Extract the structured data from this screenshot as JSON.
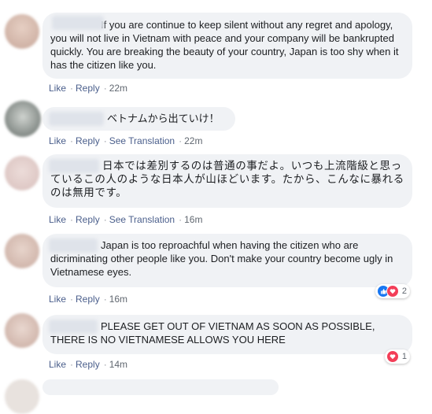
{
  "labels": {
    "like": "Like",
    "reply": "Reply",
    "see_translation": "See Translation",
    "sep": "·"
  },
  "comments": [
    {
      "text": "If you are continue to keep silent without any regret and apology, you will not live in Vietnam with peace and your company will be bankrupted quickly. You are breaking the beauty of your country, Japan is too shy when it has the citizen like you.",
      "time": "22m"
    },
    {
      "text": "ベトナムから出ていけ！",
      "time": "22m"
    },
    {
      "text": "日本では差別するのは普通の事だよ。いつも上流階級と思っているこの人のような日本人が山ほどいます。たから、こんなに暴れるのは無用です。",
      "time": "16m"
    },
    {
      "text": "Japan is too reproachful when having the citizen who are dicriminating other people like you. Don't make your country become ugly in Vietnamese eyes.",
      "time": "16m",
      "reaction_count": "2",
      "reaction_icons": [
        "like-icon",
        "love-icon"
      ]
    },
    {
      "text": "PLEASE GET OUT OF VIETNAM AS SOON AS POSSIBLE, THERE IS NO VIETNAMESE ALLOWS YOU HERE",
      "time": "14m",
      "reaction_count": "1",
      "reaction_icons": [
        "love-icon"
      ]
    }
  ],
  "colors": {
    "bubble": "#f0f2f5",
    "link": "#4b5f8c",
    "like": "#1877f2",
    "love": "#f33e58"
  }
}
